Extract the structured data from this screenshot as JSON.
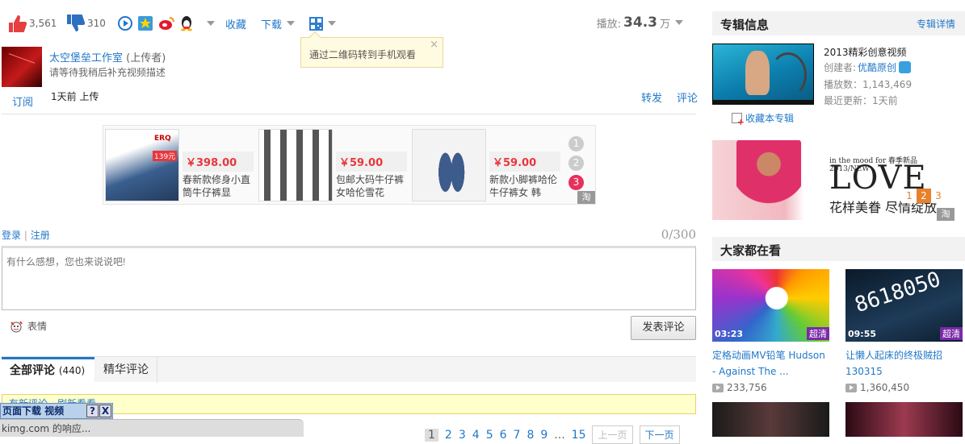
{
  "toolbar": {
    "likes": "3,561",
    "dislikes": "310",
    "collect_label": "收藏",
    "download_label": "下载",
    "play_label": "播放:",
    "play_value": "34.3",
    "play_unit": "万"
  },
  "tooltip": {
    "text": "通过二维码转到手机观看",
    "close": "×"
  },
  "uploader": {
    "name": "太空堡垒工作室",
    "role": "(上传者)",
    "desc": "请等待我稍后补充视频描述",
    "subscribe": "订阅",
    "uploaded": "1天前 上传",
    "share": "转发",
    "comment": "评论"
  },
  "ads": [
    {
      "price": "￥398.00",
      "desc": "春新款修身小直筒牛仔裤显",
      "badge": "139元"
    },
    {
      "price": "￥59.00",
      "desc": "包邮大码牛仔裤女哈伦雪花"
    },
    {
      "price": "￥59.00",
      "desc": "新款小脚裤哈伦牛仔裤女 韩"
    }
  ],
  "ad_dots": [
    "1",
    "2",
    "3"
  ],
  "ad_tag": "淘",
  "comment": {
    "login": "登录",
    "sep": "|",
    "register": "注册",
    "counter": "0/300",
    "placeholder": "有什么感想，您也来说说吧!",
    "emoji": "表情",
    "post": "发表评论"
  },
  "tabs": {
    "all": "全部评论",
    "all_count": "(440)",
    "featured": "精华评论"
  },
  "notice": "有新评论，刷新看看",
  "taskbar": {
    "text": "页面下载  视频",
    "help": "?",
    "close": "X"
  },
  "status": "kimg.com 的响应...",
  "pager": {
    "pages": [
      "1",
      "2",
      "3",
      "4",
      "5",
      "6",
      "7",
      "8",
      "9"
    ],
    "ellipsis": "...",
    "last": "15",
    "prev": "上一页",
    "next": "下一页"
  },
  "album": {
    "header": "专辑信息",
    "details": "专辑详情",
    "title": "2013精彩创意视频",
    "creator_label": "创建者:",
    "creator": "优酷原创",
    "plays": "播放数：1,143,469",
    "updated": "最近更新：1天前",
    "collect": "收藏本专辑"
  },
  "banner": {
    "small": "in the mood for 春季新品 2013/NEW",
    "love": "LOVE",
    "cn": "花样美眷 尽情绽放",
    "dots": [
      "1",
      "2",
      "3"
    ],
    "tag": "淘"
  },
  "popular": {
    "header": "大家都在看",
    "videos": [
      {
        "duration": "03:23",
        "hd": "超清",
        "title": "定格动画MV铅笔 Hudson - Against The ...",
        "views": "233,756"
      },
      {
        "duration": "09:55",
        "hd": "超清",
        "title": "让懒人起床的终极贼招130315",
        "views": "1,360,450"
      }
    ]
  }
}
